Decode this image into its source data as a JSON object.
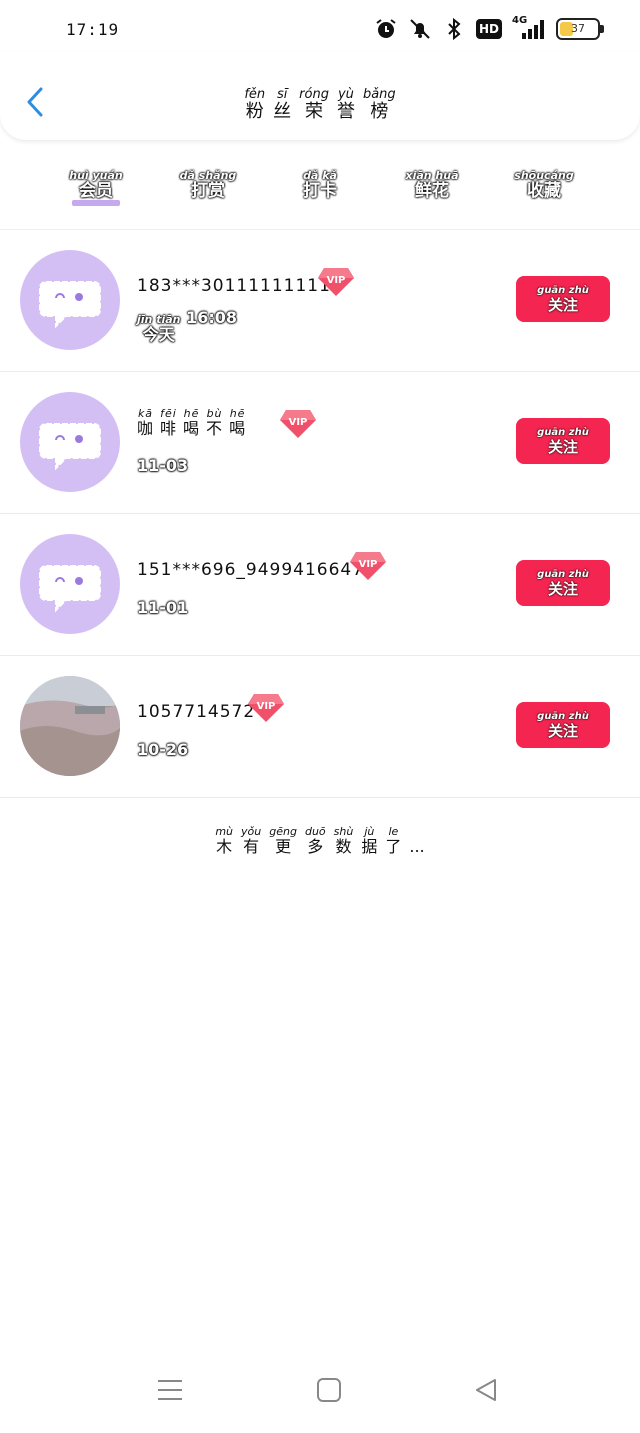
{
  "status_bar": {
    "time": "17:19",
    "network": "4G",
    "hd": "HD",
    "battery_level": 37,
    "battery_text": "37"
  },
  "header": {
    "title_chars": [
      {
        "py": "fěn",
        "hz": "粉"
      },
      {
        "py": "sī",
        "hz": "丝"
      },
      {
        "py": "róng",
        "hz": "荣"
      },
      {
        "py": "yù",
        "hz": "誉"
      },
      {
        "py": "bǎng",
        "hz": "榜"
      }
    ]
  },
  "tabs": [
    {
      "py": "huì yuán",
      "hz": "会员",
      "active": true
    },
    {
      "py": "dǎ shǎng",
      "hz": "打赏",
      "active": false
    },
    {
      "py": "dǎ kǎ",
      "hz": "打卡",
      "active": false
    },
    {
      "py": "xiān huā",
      "hz": "鲜花",
      "active": false
    },
    {
      "py": "shōucáng",
      "hz": "收藏",
      "active": false
    }
  ],
  "follow_label": {
    "py": "guān zhù",
    "hz": "关注"
  },
  "vip_label": "VIP",
  "users": [
    {
      "name": "183***30111111111",
      "date_py": "jīn tiān",
      "date_hz": "今天",
      "date_time": "16:08",
      "avatar": "default"
    },
    {
      "name_chars": [
        {
          "py": "kā",
          "hz": "咖"
        },
        {
          "py": "fēi",
          "hz": "啡"
        },
        {
          "py": "hē",
          "hz": "喝"
        },
        {
          "py": "bù",
          "hz": "不"
        },
        {
          "py": "hē",
          "hz": "喝"
        }
      ],
      "date": "11-03",
      "avatar": "default"
    },
    {
      "name": "151***696_9499416647",
      "date": "11-01",
      "avatar": "default"
    },
    {
      "name": "1057714572",
      "date": "10-26",
      "avatar": "photo"
    }
  ],
  "no_more": [
    {
      "py": "mù",
      "hz": "木"
    },
    {
      "py": "yǒu",
      "hz": "有"
    },
    {
      "py": "gēng",
      "hz": "更"
    },
    {
      "py": "duō",
      "hz": "多"
    },
    {
      "py": "shù",
      "hz": "数"
    },
    {
      "py": "jù",
      "hz": "据"
    },
    {
      "py": "le",
      "hz": "了"
    },
    {
      "py": "",
      "hz": "..."
    }
  ],
  "colors": {
    "accent_purple": "#c6a8ee",
    "avatar_purple": "#d4bff5",
    "follow_red": "#f42550",
    "back_blue": "#2e8ddf",
    "vip_red": "#f0506a"
  }
}
